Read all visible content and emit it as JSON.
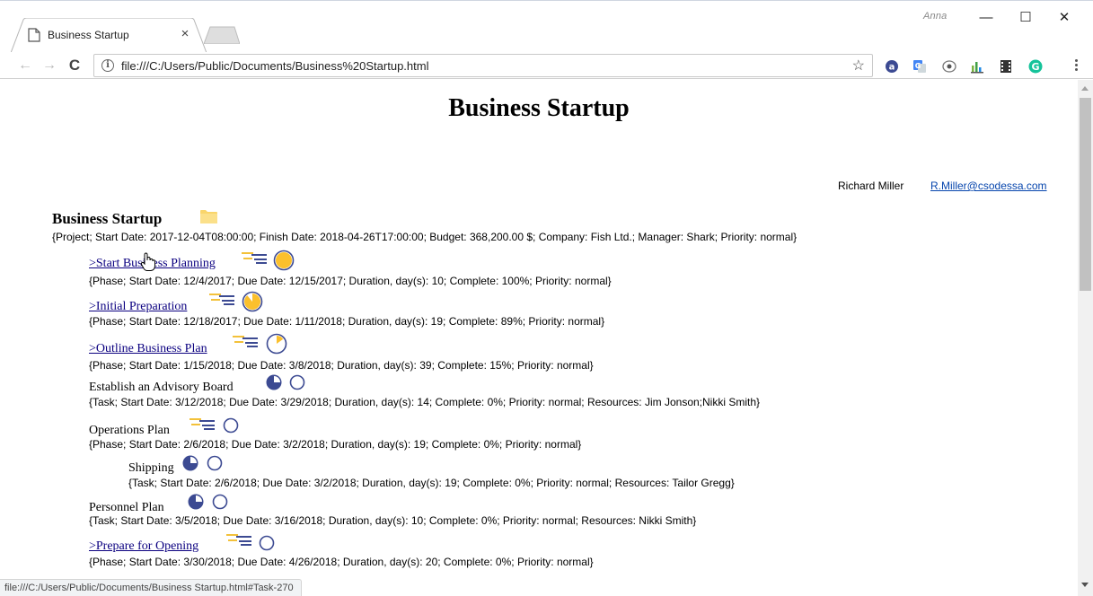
{
  "browser": {
    "tab_title": "Business Startup",
    "tab_close": "×",
    "window_user": "Anna",
    "minimize": "—",
    "maximize": "☐",
    "close": "✕",
    "url": "file:///C:/Users/Public/Documents/Business%20Startup.html",
    "status_url": "file:///C:/Users/Public/Documents/Business Startup.html#Task-270",
    "extensions": [
      "translate-icon",
      "google-translate-icon",
      "eye-extension-icon",
      "bar-chart-icon",
      "film-icon",
      "grammarly-icon"
    ]
  },
  "page": {
    "title": "Business Startup",
    "author": "Richard Miller",
    "email": "R.Miller@csodessa.com",
    "project": {
      "name": "Business Startup",
      "details": "{Project; Start Date: 2017-12-04T08:00:00; Finish Date: 2018-04-26T17:00:00; Budget: 368,200.00 $; Company: Fish Ltd.; Manager: Shark; Priority: normal}"
    },
    "items": [
      {
        "title": ">Start Business Planning",
        "details": "{Phase; Start Date: 12/4/2017; Due Date: 12/15/2017; Duration, day(s): 10; Complete: 100%; Priority: normal}",
        "kind": "phase",
        "complete": 1.0
      },
      {
        "title": ">Initial Preparation",
        "details": "{Phase; Start Date: 12/18/2017; Due Date: 1/11/2018; Duration, day(s): 19; Complete: 89%; Priority: normal}",
        "kind": "phase",
        "complete": 0.89
      },
      {
        "title": ">Outline Business Plan",
        "details": "{Phase; Start Date: 1/15/2018; Due Date: 3/8/2018; Duration, day(s): 39; Complete: 15%; Priority: normal}",
        "kind": "phase",
        "complete": 0.15
      },
      {
        "title": "Establish an Advisory Board",
        "details": "{Task; Start Date: 3/12/2018; Due Date: 3/29/2018; Duration, day(s): 14; Complete: 0%; Priority: normal; Resources: Jim Jonson;Nikki Smith}",
        "kind": "task",
        "complete": 0
      },
      {
        "title": "Operations Plan",
        "details": "{Phase; Start Date: 2/6/2018; Due Date: 3/2/2018; Duration, day(s): 19; Complete: 0%; Priority: normal}",
        "kind": "phase",
        "complete": 0
      },
      {
        "title": "Shipping",
        "details": "{Task; Start Date: 2/6/2018; Due Date: 3/2/2018; Duration, day(s): 19; Complete: 0%; Priority: normal; Resources: Tailor Gregg}",
        "kind": "task",
        "complete": 0
      },
      {
        "title": "Personnel Plan",
        "details": "{Task; Start Date: 3/5/2018; Due Date: 3/16/2018; Duration, day(s): 10; Complete: 0%; Priority: normal; Resources: Nikki Smith}",
        "kind": "task",
        "complete": 0
      },
      {
        "title": ">Prepare for Opening",
        "details": "{Phase; Start Date: 3/30/2018; Due Date: 4/26/2018; Duration, day(s): 20; Complete: 0%; Priority: normal}",
        "kind": "phase",
        "complete": 0
      }
    ]
  },
  "colors": {
    "progress_fill": "#fbc02d",
    "progress_ring": "#3c4a92",
    "clock_fill": "#3c4a92",
    "phase_bars": "#f3c13a",
    "link": "#0b0080",
    "email_link": "#0645ad"
  }
}
